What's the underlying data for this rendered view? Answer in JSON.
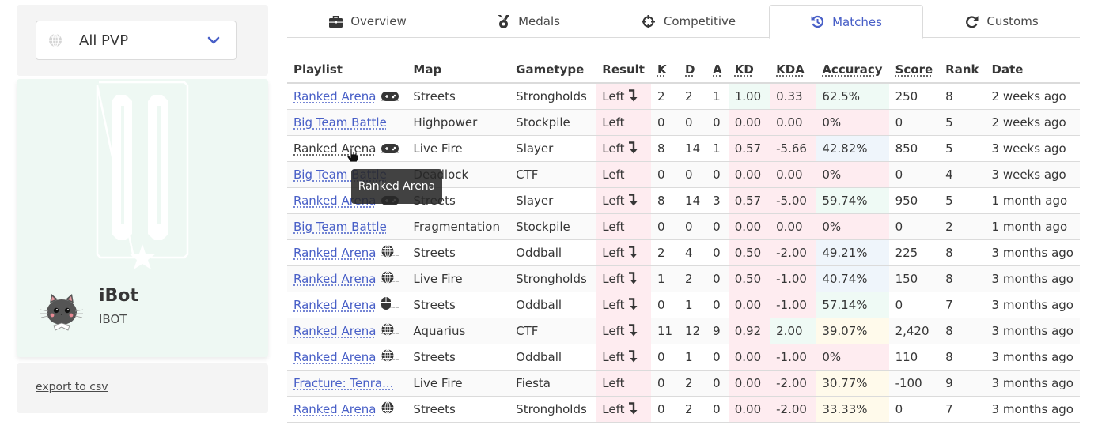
{
  "filter": {
    "selected": "All PVP",
    "icon": "globe-icon"
  },
  "profile": {
    "gamertag": "iBot",
    "service_tag": "IBOT",
    "avatar": "cat-avatar",
    "emblem": "emblem-icon"
  },
  "export": {
    "label": "export to csv"
  },
  "tabs": [
    {
      "label": "Overview",
      "icon": "briefcase-icon",
      "active": false
    },
    {
      "label": "Medals",
      "icon": "medal-icon",
      "active": false
    },
    {
      "label": "Competitive",
      "icon": "crosshairs-icon",
      "active": false
    },
    {
      "label": "Matches",
      "icon": "history-icon",
      "active": true
    },
    {
      "label": "Customs",
      "icon": "redo-icon",
      "active": false
    }
  ],
  "table": {
    "headers": [
      "Playlist",
      "Map",
      "Gametype",
      "Result",
      "K",
      "D",
      "A",
      "KD",
      "KDA",
      "Accuracy",
      "Score",
      "Rank",
      "Date"
    ],
    "rows": [
      {
        "playlist": "Ranked Arena",
        "input": "gamepad",
        "map": "Streets",
        "gametype": "Strongholds",
        "result": "Left",
        "left_early": true,
        "k": "2",
        "d": "2",
        "a": "1",
        "kd": "1.00",
        "kd_color": "green",
        "kda": "0.33",
        "kda_color": "red",
        "accuracy": "62.5%",
        "acc_color": "green",
        "score": "250",
        "rank": "8",
        "date": "2 weeks ago"
      },
      {
        "playlist": "Big Team Battle",
        "input": "",
        "map": "Highpower",
        "gametype": "Stockpile",
        "result": "Left",
        "left_early": false,
        "k": "0",
        "d": "0",
        "a": "0",
        "kd": "0.00",
        "kd_color": "red",
        "kda": "0.00",
        "kda_color": "red",
        "accuracy": "0%",
        "acc_color": "red",
        "score": "0",
        "rank": "5",
        "date": "2 weeks ago"
      },
      {
        "playlist": "Ranked Arena",
        "input": "gamepad",
        "map": "Live Fire",
        "gametype": "Slayer",
        "result": "Left",
        "left_early": true,
        "k": "8",
        "d": "14",
        "a": "1",
        "kd": "0.57",
        "kd_color": "red",
        "kda": "-5.66",
        "kda_color": "red",
        "accuracy": "42.82%",
        "acc_color": "blue",
        "score": "850",
        "rank": "5",
        "date": "3 weeks ago",
        "hovered": true
      },
      {
        "playlist": "Big Team Battle",
        "input": "",
        "map": "Deadlock",
        "gametype": "CTF",
        "result": "Left",
        "left_early": false,
        "k": "0",
        "d": "0",
        "a": "0",
        "kd": "0.00",
        "kd_color": "red",
        "kda": "0.00",
        "kda_color": "red",
        "accuracy": "0%",
        "acc_color": "red",
        "score": "0",
        "rank": "4",
        "date": "3 weeks ago"
      },
      {
        "playlist": "Ranked Arena",
        "input": "gamepad",
        "map": "Streets",
        "gametype": "Slayer",
        "result": "Left",
        "left_early": true,
        "k": "8",
        "d": "14",
        "a": "3",
        "kd": "0.57",
        "kd_color": "red",
        "kda": "-5.00",
        "kda_color": "red",
        "accuracy": "59.74%",
        "acc_color": "green",
        "score": "950",
        "rank": "5",
        "date": "1 month ago"
      },
      {
        "playlist": "Big Team Battle",
        "input": "",
        "map": "Fragmentation",
        "gametype": "Stockpile",
        "result": "Left",
        "left_early": false,
        "k": "0",
        "d": "0",
        "a": "0",
        "kd": "0.00",
        "kd_color": "red",
        "kda": "0.00",
        "kda_color": "red",
        "accuracy": "0%",
        "acc_color": "red",
        "score": "0",
        "rank": "2",
        "date": "1 month ago"
      },
      {
        "playlist": "Ranked Arena",
        "input": "crossplay",
        "map": "Streets",
        "gametype": "Oddball",
        "result": "Left",
        "left_early": true,
        "k": "2",
        "d": "4",
        "a": "0",
        "kd": "0.50",
        "kd_color": "red",
        "kda": "-2.00",
        "kda_color": "red",
        "accuracy": "49.21%",
        "acc_color": "blue",
        "score": "225",
        "rank": "8",
        "date": "3 months ago"
      },
      {
        "playlist": "Ranked Arena",
        "input": "crossplay",
        "map": "Live Fire",
        "gametype": "Strongholds",
        "result": "Left",
        "left_early": true,
        "k": "1",
        "d": "2",
        "a": "0",
        "kd": "0.50",
        "kd_color": "red",
        "kda": "-1.00",
        "kda_color": "red",
        "accuracy": "40.74%",
        "acc_color": "blue",
        "score": "150",
        "rank": "8",
        "date": "3 months ago"
      },
      {
        "playlist": "Ranked Arena",
        "input": "mouse",
        "map": "Streets",
        "gametype": "Oddball",
        "result": "Left",
        "left_early": true,
        "k": "0",
        "d": "1",
        "a": "0",
        "kd": "0.00",
        "kd_color": "red",
        "kda": "-1.00",
        "kda_color": "red",
        "accuracy": "57.14%",
        "acc_color": "green",
        "score": "0",
        "rank": "7",
        "date": "3 months ago"
      },
      {
        "playlist": "Ranked Arena",
        "input": "crossplay",
        "map": "Aquarius",
        "gametype": "CTF",
        "result": "Left",
        "left_early": true,
        "k": "11",
        "d": "12",
        "a": "9",
        "kd": "0.92",
        "kd_color": "red",
        "kda": "2.00",
        "kda_color": "green",
        "accuracy": "39.07%",
        "acc_color": "yellow",
        "score": "2,420",
        "rank": "8",
        "date": "3 months ago"
      },
      {
        "playlist": "Ranked Arena",
        "input": "crossplay",
        "map": "Streets",
        "gametype": "Oddball",
        "result": "Left",
        "left_early": true,
        "k": "0",
        "d": "1",
        "a": "0",
        "kd": "0.00",
        "kd_color": "red",
        "kda": "-1.00",
        "kda_color": "red",
        "accuracy": "0%",
        "acc_color": "red",
        "score": "110",
        "rank": "8",
        "date": "3 months ago"
      },
      {
        "playlist": "Fracture: Tenra...",
        "input": "",
        "map": "Live Fire",
        "gametype": "Fiesta",
        "result": "Left",
        "left_early": false,
        "k": "0",
        "d": "2",
        "a": "0",
        "kd": "0.00",
        "kd_color": "red",
        "kda": "-2.00",
        "kda_color": "red",
        "accuracy": "30.77%",
        "acc_color": "yellow",
        "score": "-100",
        "rank": "9",
        "date": "3 months ago"
      },
      {
        "playlist": "Ranked Arena",
        "input": "crossplay",
        "map": "Streets",
        "gametype": "Strongholds",
        "result": "Left",
        "left_early": true,
        "k": "0",
        "d": "2",
        "a": "0",
        "kd": "0.00",
        "kd_color": "red",
        "kda": "-2.00",
        "kda_color": "red",
        "accuracy": "33.33%",
        "acc_color": "yellow",
        "score": "0",
        "rank": "7",
        "date": "3 months ago"
      }
    ]
  },
  "tooltip": {
    "text": "Ranked Arena"
  },
  "colors": {
    "accent": "#485fc7",
    "bad": "#feecf0",
    "good": "#effaf5",
    "neutral": "#eff5fb",
    "warn": "#fffaeb"
  }
}
